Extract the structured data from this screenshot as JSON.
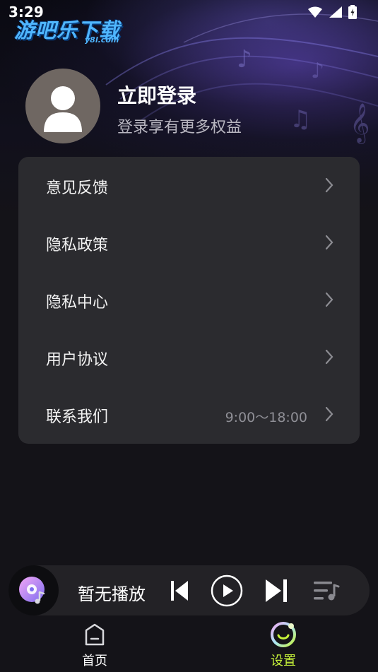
{
  "status_bar": {
    "time": "3:29"
  },
  "watermark": {
    "text": "游吧乐下载",
    "sub": "y8l.com"
  },
  "profile": {
    "title": "立即登录",
    "subtitle": "登录享有更多权益"
  },
  "menu": {
    "items": [
      {
        "label": "意见反馈",
        "extra": ""
      },
      {
        "label": "隐私政策",
        "extra": ""
      },
      {
        "label": "隐私中心",
        "extra": ""
      },
      {
        "label": "用户协议",
        "extra": ""
      },
      {
        "label": "联系我们",
        "extra": "9:00～18:00"
      }
    ]
  },
  "player": {
    "now_playing": "暂无播放",
    "icons": [
      "disc-icon",
      "previous-icon",
      "play-icon",
      "next-icon",
      "playlist-icon"
    ]
  },
  "bottom_nav": {
    "items": [
      {
        "label": "首页",
        "icon": "home-icon",
        "active": false
      },
      {
        "label": "设置",
        "icon": "settings-icon",
        "active": true
      }
    ]
  },
  "colors": {
    "background": "#141318",
    "card": "#2b2b2f",
    "accent_active": "#c6f23a",
    "muted_text": "#8f8f96",
    "nav_inactive": "#ffffff"
  }
}
